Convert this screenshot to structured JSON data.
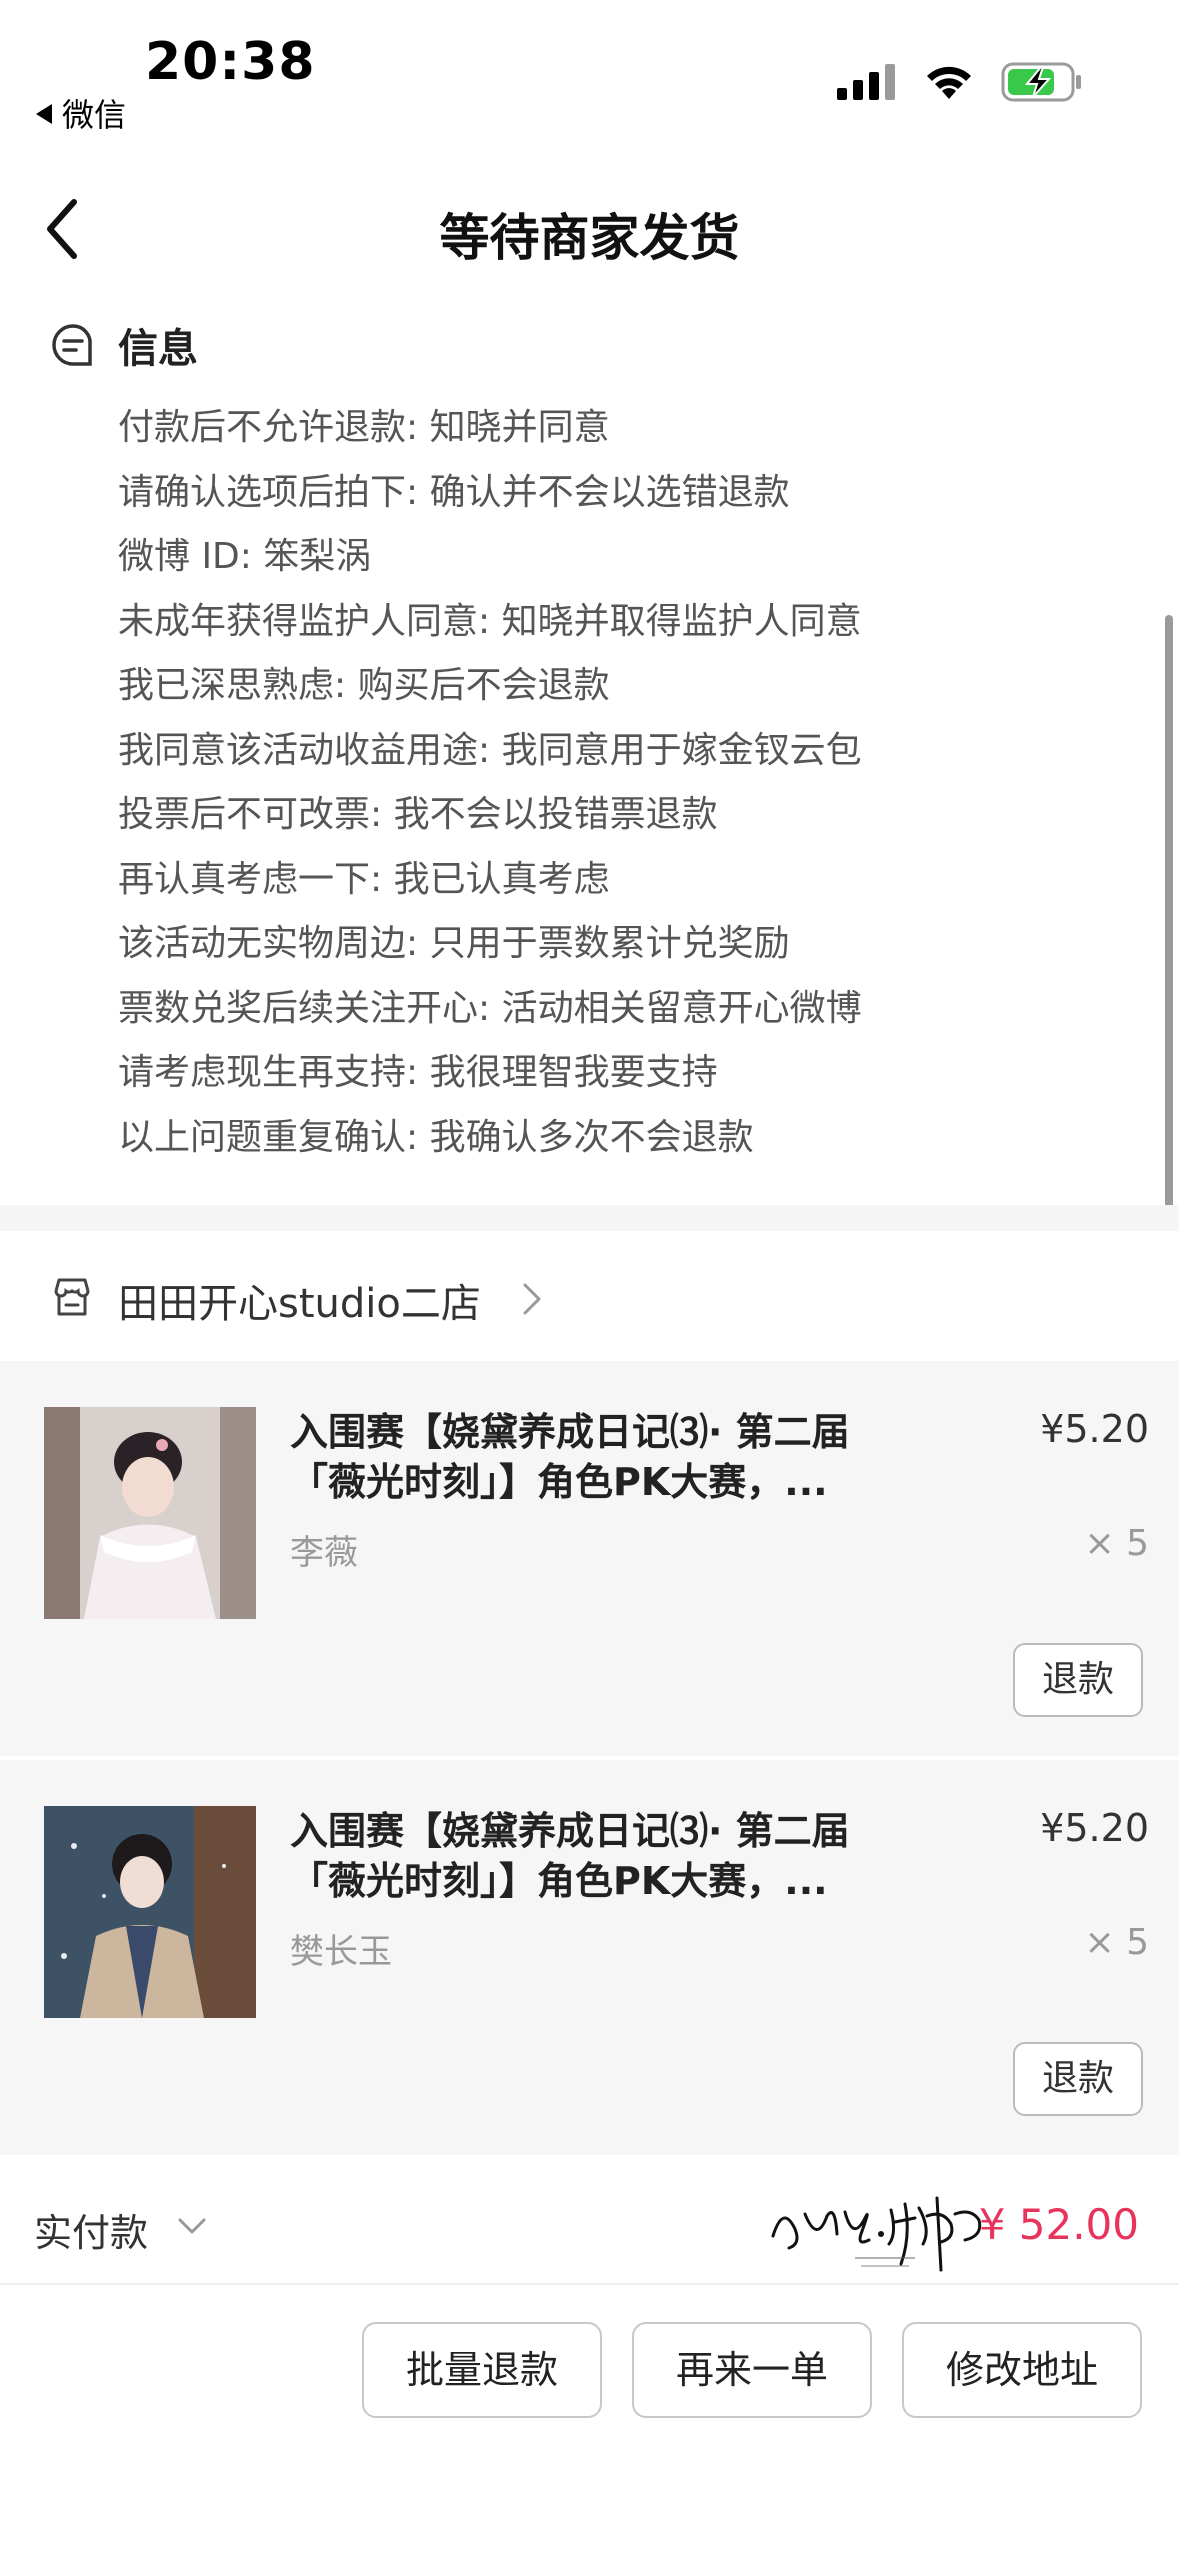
{
  "status_bar": {
    "time": "20:38",
    "back_app": "微信",
    "icons": [
      "signal-icon",
      "wifi-icon",
      "battery-charging-icon"
    ]
  },
  "nav": {
    "title": "等待商家发货",
    "back_icon": "chevron-left-icon"
  },
  "info": {
    "title": "信息",
    "icon": "message-note-icon",
    "lines": [
      "付款后不允许退款: 知晓并同意",
      "请确认选项后拍下: 确认并不会以选错退款",
      "微博 ID: 笨梨涡",
      "未成年获得监护人同意: 知晓并取得监护人同意",
      "我已深思熟虑: 购买后不会退款",
      "我同意该活动收益用途: 我同意用于嫁金钗云包",
      "投票后不可改票: 我不会以投错票退款",
      "再认真考虑一下: 我已认真考虑",
      "该活动无实物周边: 只用于票数累计兑奖励",
      "票数兑奖后续关注开心: 活动相关留意开心微博",
      "请考虑现生再支持: 我很理智我要支持",
      "以上问题重复确认: 我确认多次不会退款"
    ]
  },
  "store": {
    "name": "田田开心studio二店",
    "icon": "store-icon"
  },
  "products": [
    {
      "name": "入围赛【娆黛养成日记⑶· 第二届「薇光时刻」】角色PK大赛，...",
      "variant": "李薇",
      "price": "¥5.20",
      "qty": "× 5",
      "refund_label": "退款"
    },
    {
      "name": "入围赛【娆黛养成日记⑶· 第二届「薇光时刻」】角色PK大赛，...",
      "variant": "樊长玉",
      "price": "¥5.20",
      "qty": "× 5",
      "refund_label": "退款"
    }
  ],
  "total": {
    "label": "实付款",
    "amount": "¥ 52.00"
  },
  "actions": {
    "batch_refund": "批量退款",
    "reorder": "再来一单",
    "change_address": "修改地址"
  },
  "colors": {
    "price_accent": "#e8345c",
    "section_bg": "#f6f6f6"
  }
}
